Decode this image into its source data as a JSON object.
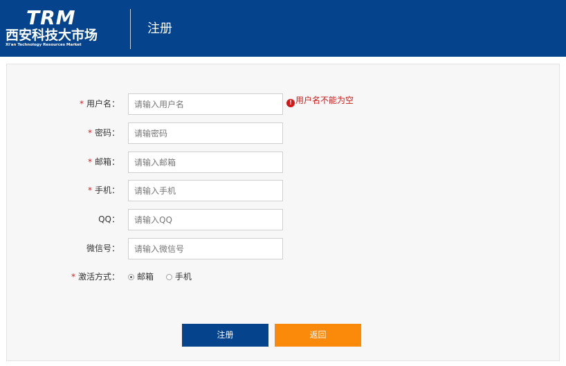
{
  "header": {
    "logo_brand": "TRM",
    "logo_cn": "西安科技大市场",
    "logo_en": "Xi'an Technology Resources Market",
    "title": "注册"
  },
  "form": {
    "fields": [
      {
        "label": "用户名：",
        "required": true,
        "placeholder": "请输入用户名",
        "value": ""
      },
      {
        "label": "密码：",
        "required": true,
        "placeholder": "请输密码",
        "value": ""
      },
      {
        "label": "邮箱：",
        "required": true,
        "placeholder": "请输入邮箱",
        "value": ""
      },
      {
        "label": "手机：",
        "required": true,
        "placeholder": "请输入手机",
        "value": ""
      },
      {
        "label": "QQ：",
        "required": false,
        "placeholder": "请输入QQ",
        "value": ""
      },
      {
        "label": "微信号：",
        "required": false,
        "placeholder": "请输入微信号",
        "value": ""
      }
    ],
    "username_error": "用户名不能为空",
    "error_icon": "!",
    "required_mark": "*",
    "activation": {
      "label": "激活方式：",
      "options": [
        {
          "label": "邮箱",
          "checked": true
        },
        {
          "label": "手机",
          "checked": false
        }
      ]
    },
    "register_button": "注册",
    "back_button": "返回"
  },
  "colors": {
    "header_bg": "#05438c",
    "register_bg": "#05438c",
    "back_bg": "#fc8a0a",
    "error": "#cc1b1b",
    "required": "#d71e1e"
  }
}
